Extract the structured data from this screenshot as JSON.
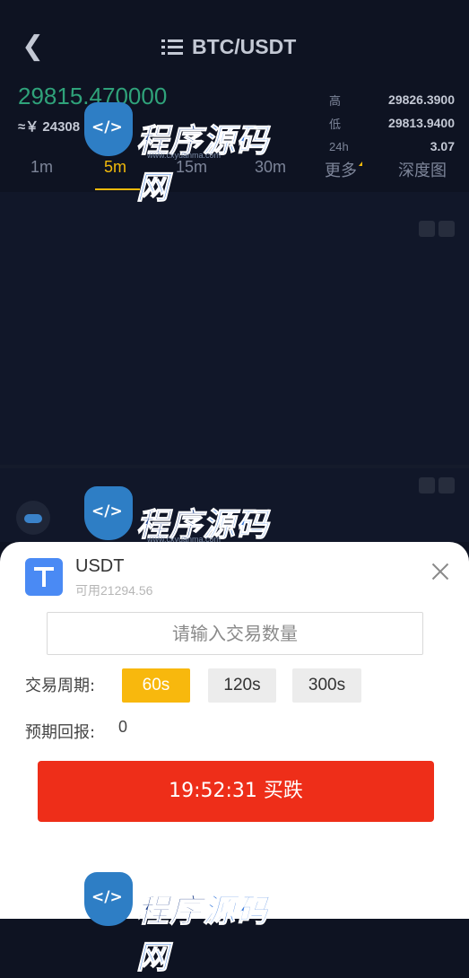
{
  "header": {
    "title": "BTC/USDT"
  },
  "ticker": {
    "price": "29815.470000",
    "cny": "≈￥ 24308",
    "stats": [
      {
        "label": "高",
        "value": "29826.3900"
      },
      {
        "label": "低",
        "value": "29813.9400"
      },
      {
        "label": "24h",
        "value": "3.07"
      }
    ]
  },
  "timeframes": [
    "1m",
    "5m",
    "15m",
    "30m",
    "更多",
    "深度图"
  ],
  "active_timeframe": "5m",
  "watermark": {
    "text_a": "程序",
    "text_b": "源码网",
    "url": "www.cxyuanma.com"
  },
  "sheet": {
    "coin": "USDT",
    "available": "可用21294.56",
    "qty_placeholder": "请输入交易数量",
    "period_label": "交易周期:",
    "periods": [
      "60s",
      "120s",
      "300s"
    ],
    "active_period": "60s",
    "expected_label": "预期回报:",
    "expected_value": "0",
    "submit_label": "19:52:31 买跌"
  },
  "colors": {
    "up": "#2fa27a",
    "accent": "#f0b90b",
    "sell": "#ee2e19",
    "period_active": "#f8b80d"
  }
}
